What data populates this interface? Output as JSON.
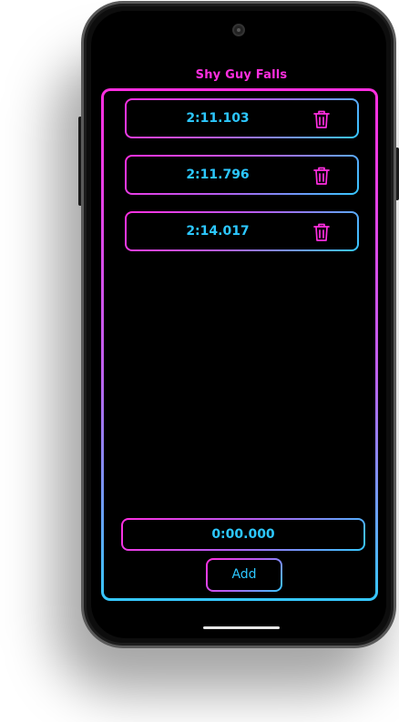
{
  "screen_title": "Shy Guy Falls",
  "times": [
    {
      "value": "2:11.103"
    },
    {
      "value": "2:11.796"
    },
    {
      "value": "2:14.017"
    }
  ],
  "time_entry": {
    "value": "0:00.000"
  },
  "add_button": {
    "label": "Add"
  },
  "colors": {
    "accent_pink": "#ff2ee0",
    "accent_blue": "#35c8ff",
    "text_blue": "#2cc7ff",
    "background": "#000000"
  },
  "icons": {
    "row_action": "trash-icon"
  }
}
